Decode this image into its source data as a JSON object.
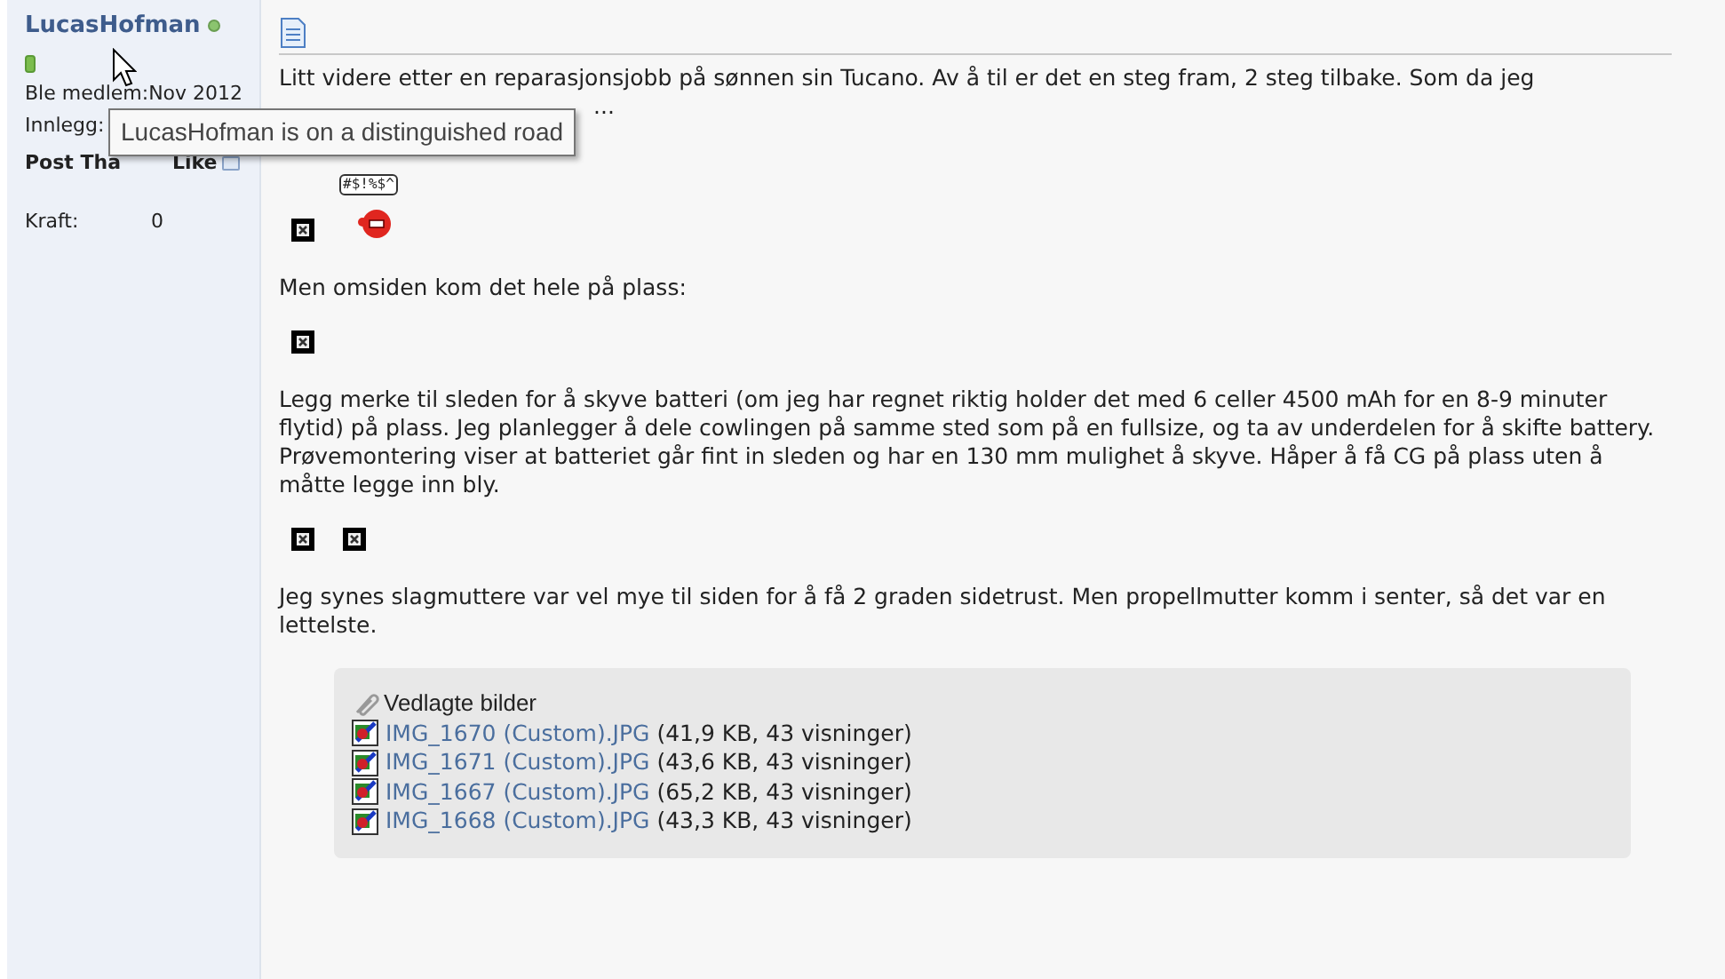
{
  "user": {
    "name": "LucasHofman",
    "online": true,
    "fields": [
      {
        "label": "Ble medlem:",
        "value": "Nov 2012"
      },
      {
        "label": "Innlegg:"
      }
    ],
    "thanks_heading": "Post Tha",
    "thanks_tail": "Like",
    "stats": [
      {
        "label": "Kraft:",
        "value": "0"
      }
    ]
  },
  "tooltip": "LucasHofman is on a distinguished road",
  "post": {
    "blocks": [
      {
        "kind": "text",
        "text": "Litt videre etter en reparasjonsjobb på sønnen sin Tucano. Av å til er det en steg fram, 2 steg tilbake. Som da jeg"
      },
      {
        "kind": "cut",
        "text": "..."
      },
      {
        "kind": "images",
        "items": [
          {
            "kind": "broken"
          },
          {
            "kind": "smiley",
            "text": "#$!%$^"
          }
        ]
      },
      {
        "kind": "text",
        "text": "Men omsiden kom det hele på plass:"
      },
      {
        "kind": "images",
        "items": [
          {
            "kind": "broken"
          }
        ]
      },
      {
        "kind": "text",
        "text": "Legg merke til sleden for å skyve batteri (om jeg har regnet riktig holder det med 6 celler 4500 mAh for en 8-9 minuter flytid) på plass. Jeg planlegger å dele cowlingen på samme sted som på en fullsize, og ta av underdelen for å skifte battery. Prøvemontering viser at batteriet går fint in sleden og har en 130 mm mulighet å skyve. Håper å få CG på plass uten å måtte legge inn bly."
      },
      {
        "kind": "images",
        "items": [
          {
            "kind": "broken"
          },
          {
            "kind": "broken"
          }
        ]
      },
      {
        "kind": "text",
        "text": "Jeg synes slagmuttere var vel mye til siden for å få 2 graden sidetrust. Men propellmutter komm i senter, så det var en lettelste."
      }
    ],
    "attachments": {
      "title": "Vedlagte bilder",
      "files": [
        {
          "name": "IMG_1670 (Custom).JPG",
          "info": "(41,9 KB, 43 visninger)"
        },
        {
          "name": "IMG_1671 (Custom).JPG",
          "info": "(43,6 KB, 43 visninger)"
        },
        {
          "name": "IMG_1667 (Custom).JPG",
          "info": "(65,2 KB, 43 visninger)"
        },
        {
          "name": "IMG_1668 (Custom).JPG",
          "info": "(43,3 KB, 43 visninger)"
        }
      ]
    }
  }
}
